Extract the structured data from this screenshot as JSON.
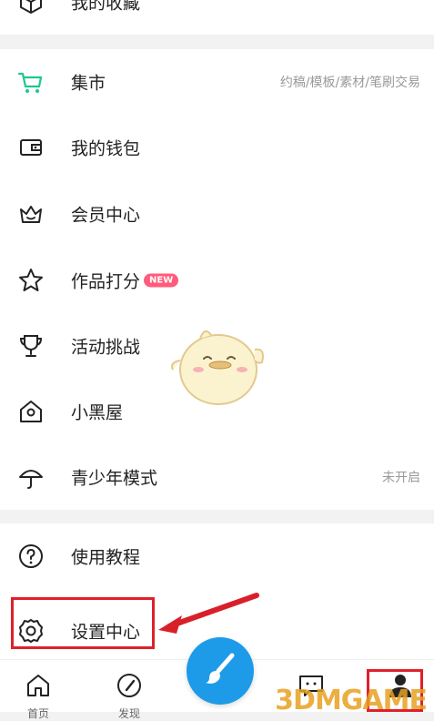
{
  "menu_top": {
    "favorites": {
      "label": "我的收藏",
      "icon": "cube-icon"
    }
  },
  "menu_main": [
    {
      "key": "market",
      "label": "集市",
      "hint": "约稿/模板/素材/笔刷交易",
      "icon": "cart-icon"
    },
    {
      "key": "wallet",
      "label": "我的钱包",
      "hint": "",
      "icon": "wallet-icon"
    },
    {
      "key": "membership",
      "label": "会员中心",
      "hint": "",
      "icon": "crown-icon"
    },
    {
      "key": "rating",
      "label": "作品打分",
      "badge": "NEW",
      "hint": "",
      "icon": "star-icon"
    },
    {
      "key": "challenge",
      "label": "活动挑战",
      "hint": "",
      "icon": "trophy-icon"
    },
    {
      "key": "blackhouse",
      "label": "小黑屋",
      "hint": "",
      "icon": "house-icon"
    },
    {
      "key": "teen",
      "label": "青少年模式",
      "hint": "未开启",
      "icon": "umbrella-icon"
    }
  ],
  "menu_bottom": [
    {
      "key": "tutorial",
      "label": "使用教程",
      "icon": "question-icon"
    },
    {
      "key": "settings",
      "label": "设置中心",
      "icon": "gear-icon"
    }
  ],
  "bottom_nav": [
    {
      "key": "home",
      "label": "首页",
      "icon": "home-icon"
    },
    {
      "key": "discover",
      "label": "发现",
      "icon": "compass-icon"
    },
    {
      "key": "create",
      "label": "",
      "icon": "brush-icon"
    },
    {
      "key": "messages",
      "label": "",
      "icon": "chat-icon"
    },
    {
      "key": "profile",
      "label": "",
      "icon": "person-icon"
    }
  ],
  "watermark": "3DMGAME",
  "colors": {
    "accent_green": "#1dc98a",
    "highlight_red": "#e0202a",
    "fab_blue": "#1d9be9",
    "badge_pink": "#ff5b7b"
  }
}
